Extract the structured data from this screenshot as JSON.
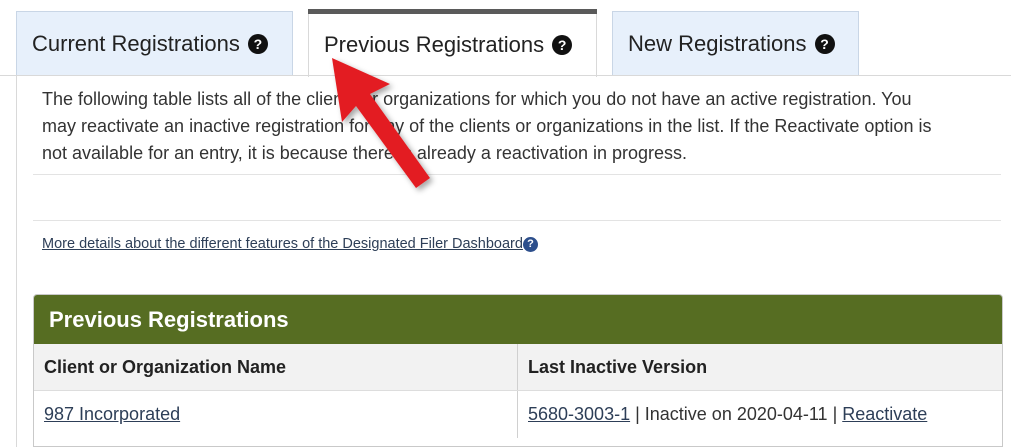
{
  "tabs": [
    {
      "label": "Current Registrations",
      "help_icon": "question-circle-icon",
      "active": false
    },
    {
      "label": "Previous Registrations",
      "help_icon": "question-circle-icon",
      "active": true
    },
    {
      "label": "New Registrations",
      "help_icon": "question-circle-icon",
      "active": false
    }
  ],
  "intro": {
    "line1": "The following table lists all of the clients or organizations for which you do not have an active registration. You",
    "line2": "may reactivate an inactive registration for any of the clients or organizations in the list. If the Reactivate option is",
    "line3": "not available for an entry, it is because there is already a reactivation in progress."
  },
  "details_link": {
    "text": "More details about the different features of the Designated Filer Dashboard",
    "icon": "question-circle-icon"
  },
  "panel": {
    "title": "Previous Registrations",
    "columns": [
      "Client or Organization Name",
      "Last Inactive Version"
    ],
    "rows": [
      {
        "client": "987 Incorporated",
        "version_link": "5680-3003-1",
        "status": " | Inactive on 2020-04-11 | ",
        "action": "Reactivate"
      }
    ]
  },
  "colors": {
    "panel_header": "#566d22",
    "tab_inactive": "#e7f0fb",
    "annotation_arrow": "#e31e24"
  },
  "annotation": {
    "icon": "red-pointer-arrow-icon"
  }
}
